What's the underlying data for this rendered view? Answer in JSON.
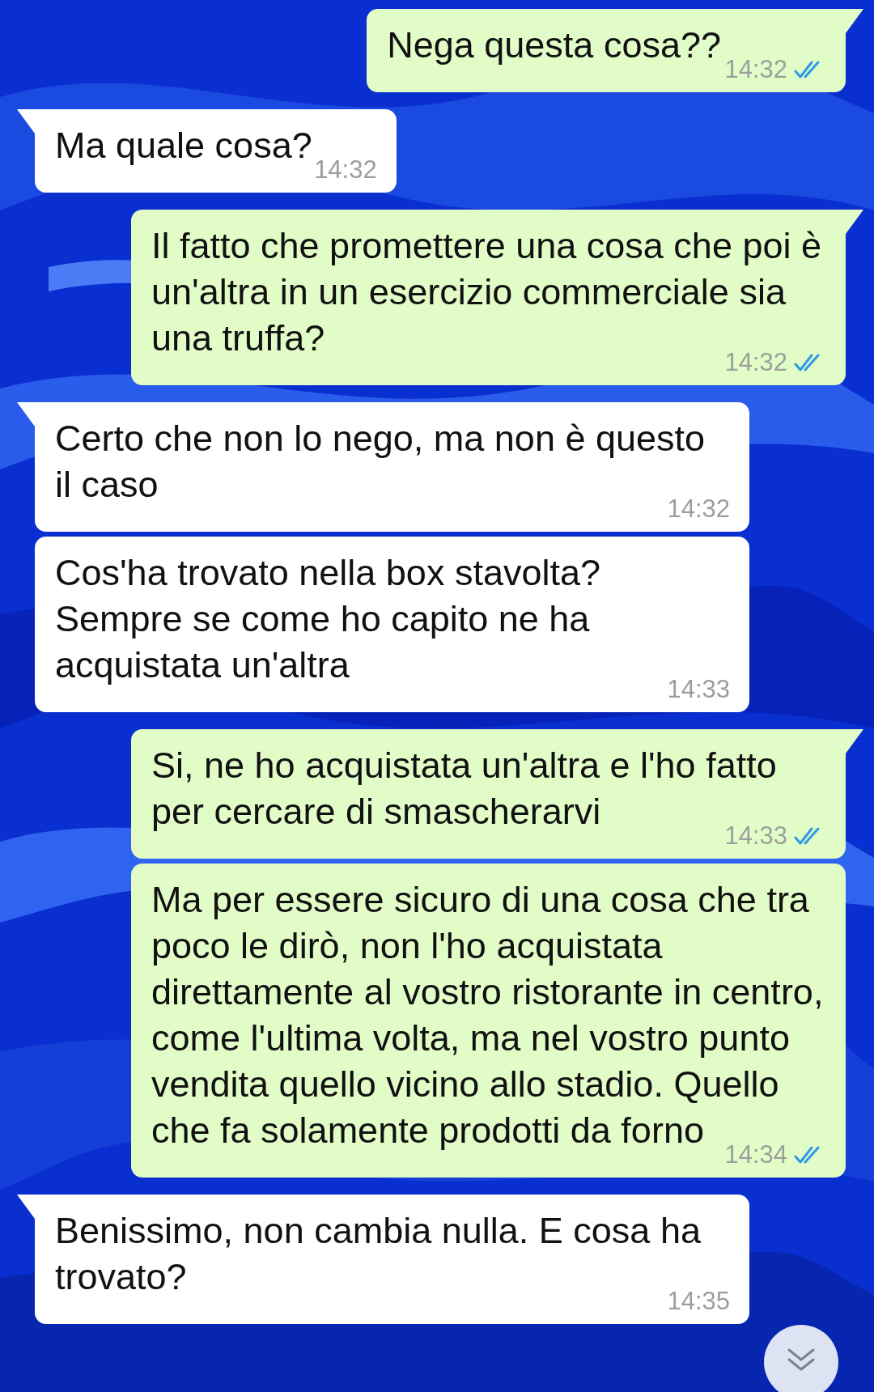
{
  "messages": [
    {
      "kind": "outgoing",
      "tail": true,
      "text": "Nega questa cosa??",
      "time": "14:32",
      "read": true
    },
    {
      "kind": "incoming",
      "tail": true,
      "text": "Ma quale cosa?",
      "time": "14:32"
    },
    {
      "kind": "outgoing",
      "tail": true,
      "text": "Il fatto che promettere una cosa che poi è un'altra in un esercizio commerciale sia una truffa?",
      "time": "14:32",
      "read": true
    },
    {
      "kind": "incoming",
      "tail": true,
      "text": "Certo che non lo nego, ma non è questo il caso",
      "time": "14:32"
    },
    {
      "kind": "incoming",
      "tail": false,
      "text": "Cos'ha trovato nella box stavolta? Sempre se come ho capito ne ha acquistata un'altra",
      "time": "14:33"
    },
    {
      "kind": "outgoing",
      "tail": true,
      "text": "Si, ne ho acquistata un'altra e l'ho fatto per cercare di smascherarvi",
      "time": "14:33",
      "read": true
    },
    {
      "kind": "outgoing",
      "tail": false,
      "text": "Ma per essere sicuro di una cosa che tra poco le dirò, non l'ho acquistata direttamente al vostro ristorante in centro, come l'ultima volta, ma nel vostro punto vendita quello vicino allo stadio. Quello che fa solamente prodotti da forno",
      "time": "14:34",
      "read": true
    },
    {
      "kind": "incoming",
      "tail": true,
      "text": "Benissimo, non cambia nulla. E cosa ha trovato?",
      "time": "14:35"
    }
  ]
}
